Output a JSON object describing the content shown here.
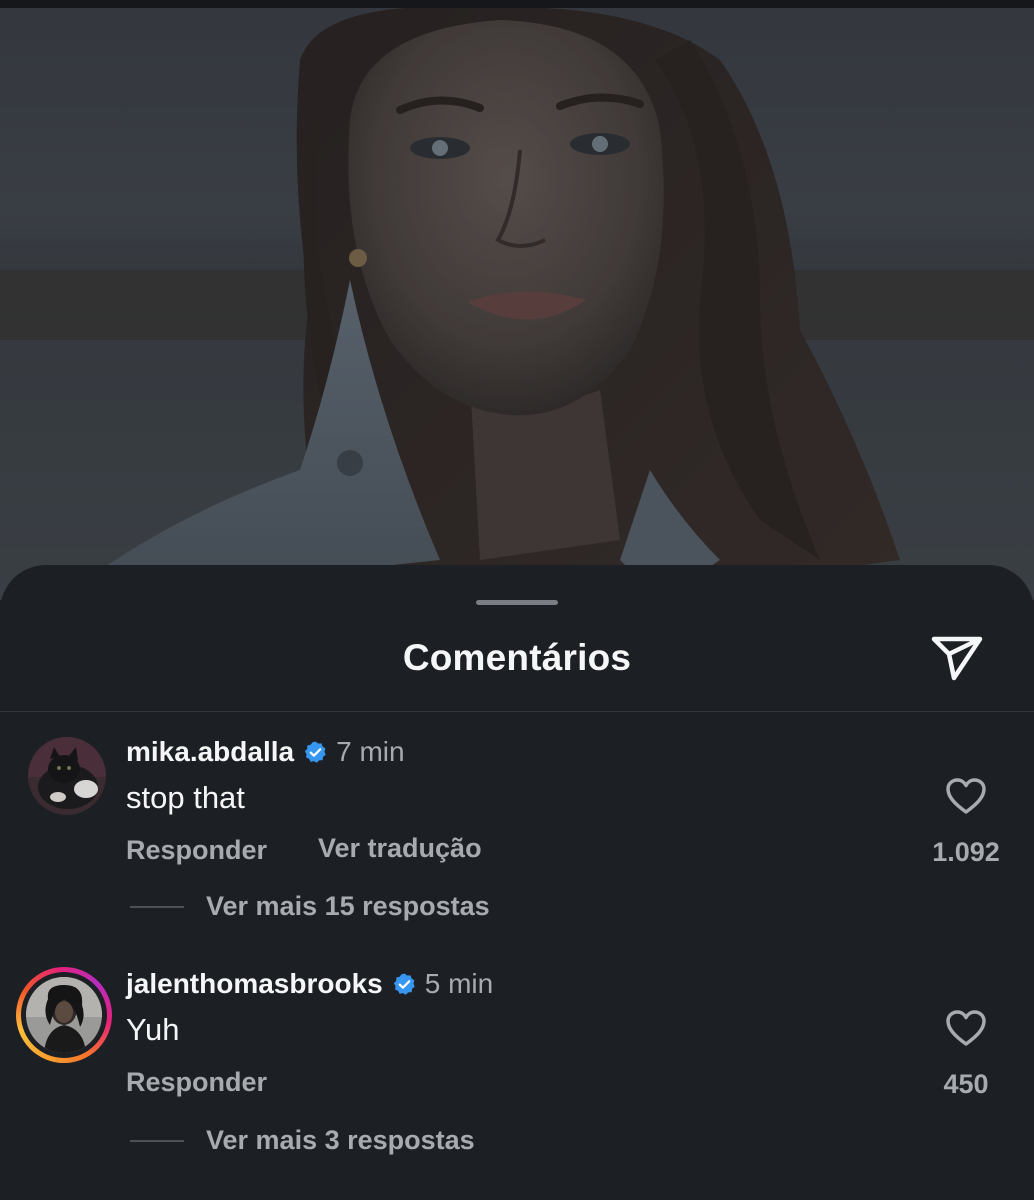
{
  "sheet": {
    "title": "Comentários",
    "share_icon": "send-paper-plane-icon"
  },
  "comments": [
    {
      "username": "mika.abdalla",
      "verified": true,
      "time": "7 min",
      "text": "stop that",
      "actions": [
        "Responder",
        "Ver tradução"
      ],
      "likes": "1.092",
      "view_replies": "Ver mais 15 respostas",
      "has_story_ring": false
    },
    {
      "username": "jalenthomasbrooks",
      "verified": true,
      "time": "5 min",
      "text": "Yuh",
      "actions": [
        "Responder"
      ],
      "likes": "450",
      "view_replies": "Ver mais 3 respostas",
      "has_story_ring": true
    }
  ],
  "colors": {
    "background": "#1c1f23",
    "verified_badge": "#3797f0",
    "secondary_text": "#a7abb0",
    "primary_text": "#f5f6f7"
  }
}
